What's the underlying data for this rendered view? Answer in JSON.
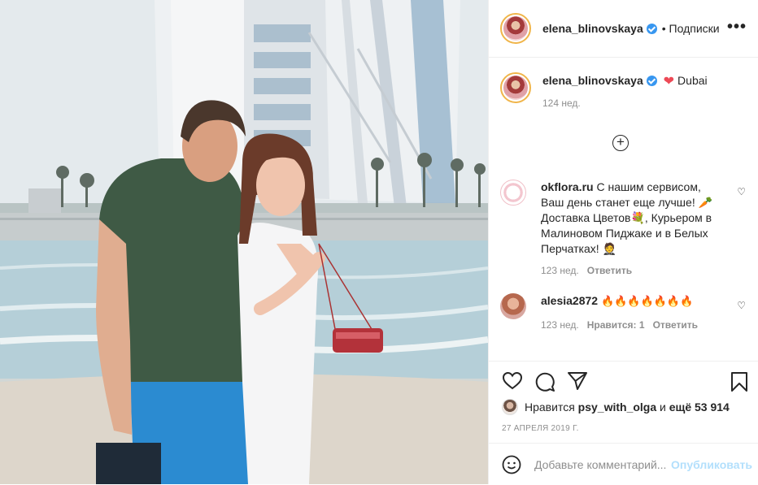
{
  "post": {
    "author": "elena_blinovskaya",
    "follow_label": "• Подписки",
    "more_label": "•••"
  },
  "caption": {
    "author": "elena_blinovskaya",
    "heart": "❤",
    "text": "Dubai",
    "time": "124 нед."
  },
  "comments": [
    {
      "author": "okflora.ru",
      "text": "С нашим сервисом, Ваш день станет еще лучше! 🥕 Доставка Цветов💐, Курьером в Малиновом Пиджаке и в Белых Перчатках! 🤵",
      "time": "123 нед.",
      "reply": "Ответить"
    },
    {
      "author": "alesia2872",
      "text": "🔥🔥🔥🔥🔥🔥🔥",
      "time": "123 нед.",
      "likes": "Нравится: 1",
      "reply": "Ответить"
    }
  ],
  "likes": {
    "prefix": "Нравится",
    "user": "psy_with_olga",
    "and": "и",
    "rest": "ещё 53 914"
  },
  "date": "27 АПРЕЛЯ 2019 Г.",
  "add_comment": {
    "placeholder": "Добавьте комментарий...",
    "publish": "Опубликовать"
  },
  "icons": [
    "heart-icon",
    "comment-icon",
    "share-icon",
    "bookmark-icon",
    "emoji-icon",
    "plus-icon",
    "verified-icon"
  ],
  "colors": {
    "verified": "#3897f0",
    "publish": "#b2dffc",
    "meta": "#8e8e8e"
  }
}
